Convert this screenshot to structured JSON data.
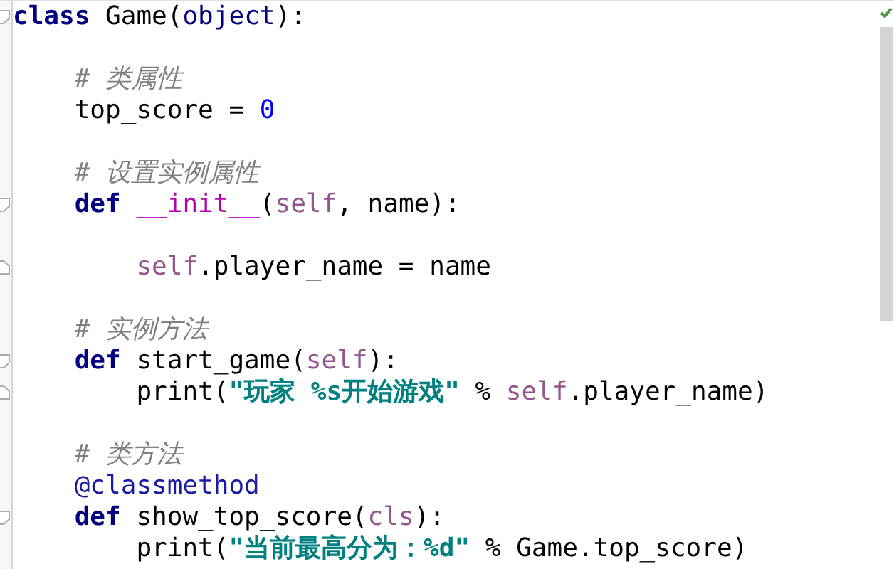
{
  "editor": {
    "lines": [
      {
        "kind": "code",
        "fold_start": true,
        "fold_end": false,
        "tokens": [
          {
            "kind": "keyword",
            "text": "class"
          },
          {
            "kind": "plain",
            "text": " Game("
          },
          {
            "kind": "builtin",
            "text": "object"
          },
          {
            "kind": "plain",
            "text": "):"
          }
        ],
        "children": [
          {
            "kind": "blank"
          },
          {
            "kind": "code",
            "fold_start": false,
            "fold_end": false,
            "tokens": [
              {
                "kind": "comment",
                "text": "# 类属性"
              }
            ]
          },
          {
            "kind": "code",
            "fold_start": false,
            "fold_end": false,
            "tokens": [
              {
                "kind": "plain",
                "text": "top_score = "
              },
              {
                "kind": "number",
                "text": "0"
              }
            ]
          },
          {
            "kind": "blank"
          },
          {
            "kind": "code",
            "fold_start": false,
            "fold_end": false,
            "tokens": [
              {
                "kind": "comment",
                "text": "# 设置实例属性"
              }
            ]
          },
          {
            "kind": "code",
            "fold_start": true,
            "fold_end": false,
            "tokens": [
              {
                "kind": "keyword",
                "text": "def "
              },
              {
                "kind": "magic",
                "text": "__init__"
              },
              {
                "kind": "plain",
                "text": "("
              },
              {
                "kind": "self",
                "text": "self"
              },
              {
                "kind": "plain",
                "text": ", name):"
              }
            ],
            "children": [
              {
                "kind": "blank"
              },
              {
                "kind": "code",
                "fold_start": false,
                "fold_end": true,
                "tokens": [
                  {
                    "kind": "self",
                    "text": "self"
                  },
                  {
                    "kind": "plain",
                    "text": ".player_name = name"
                  }
                ]
              }
            ]
          },
          {
            "kind": "blank"
          },
          {
            "kind": "code",
            "fold_start": false,
            "fold_end": false,
            "tokens": [
              {
                "kind": "comment",
                "text": "# 实例方法"
              }
            ]
          },
          {
            "kind": "code",
            "fold_start": true,
            "fold_end": false,
            "tokens": [
              {
                "kind": "keyword",
                "text": "def"
              },
              {
                "kind": "plain",
                "text": " start_game("
              },
              {
                "kind": "self",
                "text": "self"
              },
              {
                "kind": "plain",
                "text": "):"
              }
            ],
            "children": [
              {
                "kind": "code",
                "fold_start": false,
                "fold_end": true,
                "tokens": [
                  {
                    "kind": "plain",
                    "text": "print("
                  },
                  {
                    "kind": "string",
                    "text": "\"玩家 %s开始游戏\""
                  },
                  {
                    "kind": "plain",
                    "text": " % "
                  },
                  {
                    "kind": "self",
                    "text": "self"
                  },
                  {
                    "kind": "plain",
                    "text": ".player_name)"
                  }
                ]
              }
            ]
          },
          {
            "kind": "blank"
          },
          {
            "kind": "code",
            "fold_start": false,
            "fold_end": false,
            "tokens": [
              {
                "kind": "comment",
                "text": "# 类方法"
              }
            ]
          },
          {
            "kind": "code",
            "fold_start": false,
            "fold_end": false,
            "tokens": [
              {
                "kind": "decorator",
                "text": "@classmethod"
              }
            ]
          },
          {
            "kind": "code",
            "fold_start": true,
            "fold_end": false,
            "tokens": [
              {
                "kind": "keyword",
                "text": "def"
              },
              {
                "kind": "plain",
                "text": " show_top_score("
              },
              {
                "kind": "self",
                "text": "cls"
              },
              {
                "kind": "plain",
                "text": "):"
              }
            ],
            "children": [
              {
                "kind": "code",
                "fold_start": false,
                "fold_end": false,
                "tokens": [
                  {
                    "kind": "plain",
                    "text": "print("
                  },
                  {
                    "kind": "string",
                    "text": "\"当前最高分为：%d\""
                  },
                  {
                    "kind": "plain",
                    "text": " % Game.top_score)"
                  }
                ]
              }
            ]
          }
        ]
      }
    ]
  }
}
